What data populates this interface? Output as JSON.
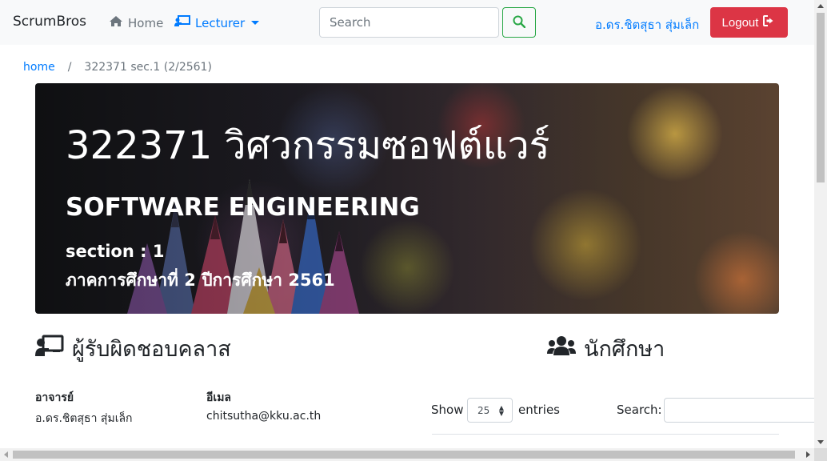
{
  "navbar": {
    "brand": "ScrumBros",
    "home_label": "Home",
    "lecturer_label": "Lecturer",
    "search_placeholder": "Search",
    "user_name": "อ.ดร.ชิตสุธา สุ่มเล็ก",
    "logout_label": "Logout",
    "icons": {
      "home": "home-icon",
      "lecturer": "chalkboard-teacher-icon",
      "search": "search-icon",
      "logout": "sign-out-icon"
    }
  },
  "breadcrumb": {
    "home": "home",
    "separator": "/",
    "current": "322371 sec.1 (2/2561)"
  },
  "hero": {
    "title": "322371 วิศวกรรมซอฟต์แวร์",
    "subtitle": "SOFTWARE ENGINEERING",
    "section": "section : 1",
    "term": "ภาคการศึกษาที่ 2 ปีการศึกษา 2561"
  },
  "responsible": {
    "heading": "ผู้รับผิดชอบคลาส",
    "icon": "chalkboard-teacher-icon",
    "lecturer_label": "อาจารย์",
    "lecturer_value": "อ.ดร.ชิตสุธา สุ่มเล็ก",
    "email_label": "อีเมล",
    "email_value": "chitsutha@kku.ac.th"
  },
  "students": {
    "heading": "นักศึกษา",
    "icon": "users-icon",
    "show_label": "Show",
    "entries_value": "25",
    "entries_label": "entries",
    "search_label": "Search:"
  },
  "colors": {
    "primary": "#007bff",
    "danger": "#dc3545",
    "success": "#28a745",
    "navbar_bg": "#f8f9fa"
  }
}
